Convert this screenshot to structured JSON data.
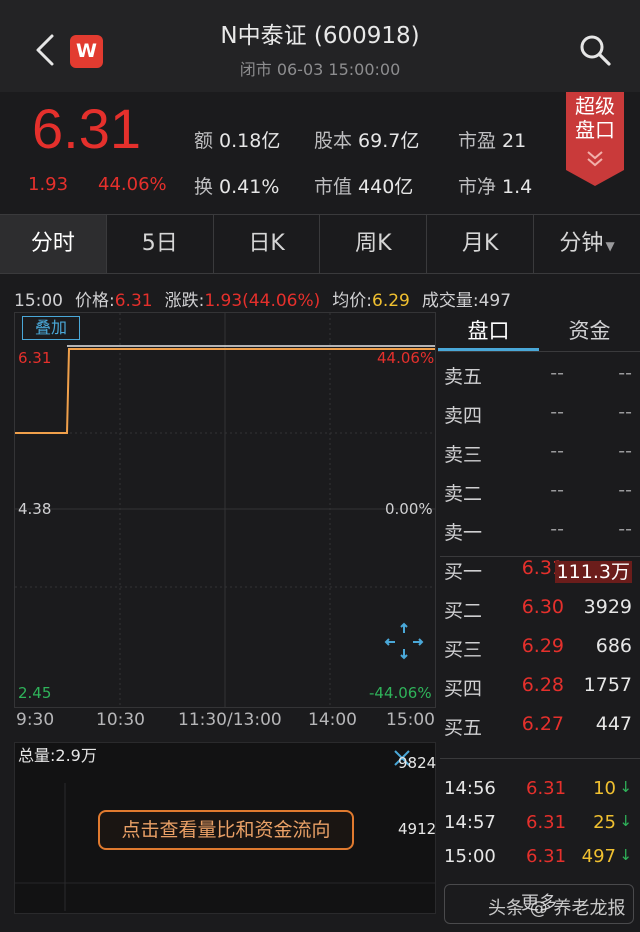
{
  "header": {
    "title": "N中泰证 (600918)",
    "subtitle": "闭市 06-03 15:00:00",
    "logo_letter": "W"
  },
  "quote": {
    "price": "6.31",
    "change": "1.93",
    "change_pct": "44.06%",
    "stats": {
      "amount": {
        "label": "额",
        "value": "0.18亿"
      },
      "share_capital": {
        "label": "股本",
        "value": "69.7亿"
      },
      "pe": {
        "label": "市盈",
        "value": "21"
      },
      "turnover": {
        "label": "换",
        "value": "0.41%"
      },
      "market_cap": {
        "label": "市值",
        "value": "440亿"
      },
      "pb": {
        "label": "市净",
        "value": "1.4"
      }
    },
    "badge": [
      "超级",
      "盘口"
    ]
  },
  "tabs": [
    "分时",
    "5日",
    "日K",
    "周K",
    "月K",
    "分钟"
  ],
  "infobar": {
    "time": "15:00",
    "price_label": "价格:",
    "price_value": "6.31",
    "change_label": "涨跌:",
    "change_value": "1.93(44.06%)",
    "avg_label": "均价:",
    "avg_value": "6.29",
    "volume_label": "成交量:",
    "volume_value": "497"
  },
  "chart": {
    "overlay_label": "叠加",
    "y_left": [
      "6.31",
      "4.38",
      "2.45"
    ],
    "y_right": [
      "44.06%",
      "0.00%",
      "-44.06%"
    ],
    "time_labels": [
      "9:30",
      "10:30",
      "11:30/13:00",
      "14:00",
      "15:00"
    ]
  },
  "chart_data": {
    "type": "line",
    "x": [
      "9:30",
      "9:31",
      "15:00"
    ],
    "series": [
      {
        "values": [
          4.38,
          6.31,
          6.31
        ]
      }
    ],
    "ylim": [
      2.45,
      6.31
    ],
    "colors": {
      "price": "#f0a04b",
      "avg": "#e6e6e6"
    }
  },
  "volume": {
    "title": "总量:2.9万",
    "max_label": "9824",
    "mid_label": "4912",
    "button_label": "点击查看量比和资金流向"
  },
  "panel": {
    "tabs": [
      "盘口",
      "资金"
    ],
    "asks": [
      {
        "label": "卖五",
        "price": "--",
        "vol": "--"
      },
      {
        "label": "卖四",
        "price": "--",
        "vol": "--"
      },
      {
        "label": "卖三",
        "price": "--",
        "vol": "--"
      },
      {
        "label": "卖二",
        "price": "--",
        "vol": "--"
      },
      {
        "label": "卖一",
        "price": "--",
        "vol": "--"
      }
    ],
    "bids": [
      {
        "label": "买一",
        "price": "6.31",
        "vol": "111.3万"
      },
      {
        "label": "买二",
        "price": "6.30",
        "vol": "3929"
      },
      {
        "label": "买三",
        "price": "6.29",
        "vol": "686"
      },
      {
        "label": "买四",
        "price": "6.28",
        "vol": "1757"
      },
      {
        "label": "买五",
        "price": "6.27",
        "vol": "447"
      }
    ],
    "ticks": [
      {
        "time": "14:56",
        "price": "6.31",
        "vol": "10",
        "dir": "↓"
      },
      {
        "time": "14:57",
        "price": "6.31",
        "vol": "25",
        "dir": "↓"
      },
      {
        "time": "15:00",
        "price": "6.31",
        "vol": "497",
        "dir": "↓"
      }
    ],
    "detail_label": "更多",
    "watermark": "头条 @ 养老龙报"
  },
  "colors": {
    "up": "#e5302c",
    "down": "#2fb35a",
    "accent": "#4aa8d8",
    "line": "#f0a04b"
  }
}
